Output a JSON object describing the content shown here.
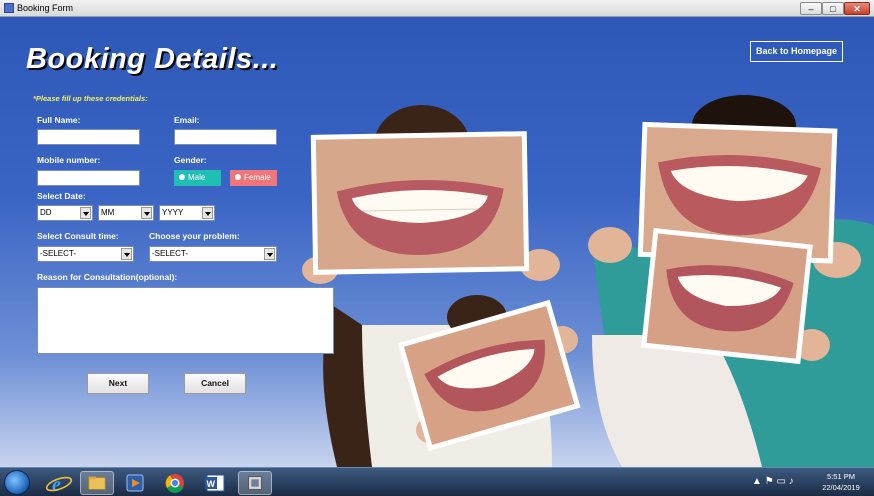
{
  "window": {
    "title": "Booking Form",
    "minimize": "–",
    "maximize": "□",
    "close": "✕"
  },
  "header": {
    "title": "Booking Details...",
    "back_label": "Back to Homepage"
  },
  "form": {
    "hint": "*Please fill up these credentials:",
    "full_name_label": "Full Name:",
    "email_label": "Email:",
    "mobile_label": "Mobile number:",
    "gender_label": "Gender:",
    "gender_male": "Male",
    "gender_female": "Female",
    "date_label": "Select Date:",
    "date_day": "DD",
    "date_month": "MM",
    "date_year": "YYYY",
    "consult_time_label": "Select Consult time:",
    "consult_time_value": "-SELECT-",
    "problem_label": "Choose your problem:",
    "problem_value": "-SELECT-",
    "reason_label": "Reason for Consultation(optional):",
    "next_label": "Next",
    "cancel_label": "Cancel"
  },
  "colors": {
    "male": "#1fbfb4",
    "female": "#f2757a",
    "hint": "#f3ef5a",
    "background": "#3a65c4"
  },
  "taskbar": {
    "icons": [
      "start-orb-icon",
      "internet-explorer-icon",
      "file-explorer-icon",
      "media-player-icon",
      "chrome-icon",
      "word-icon",
      "app-icon"
    ],
    "tray_arrow": "▲",
    "time": "5:51 PM",
    "date": "22/04/2019"
  }
}
